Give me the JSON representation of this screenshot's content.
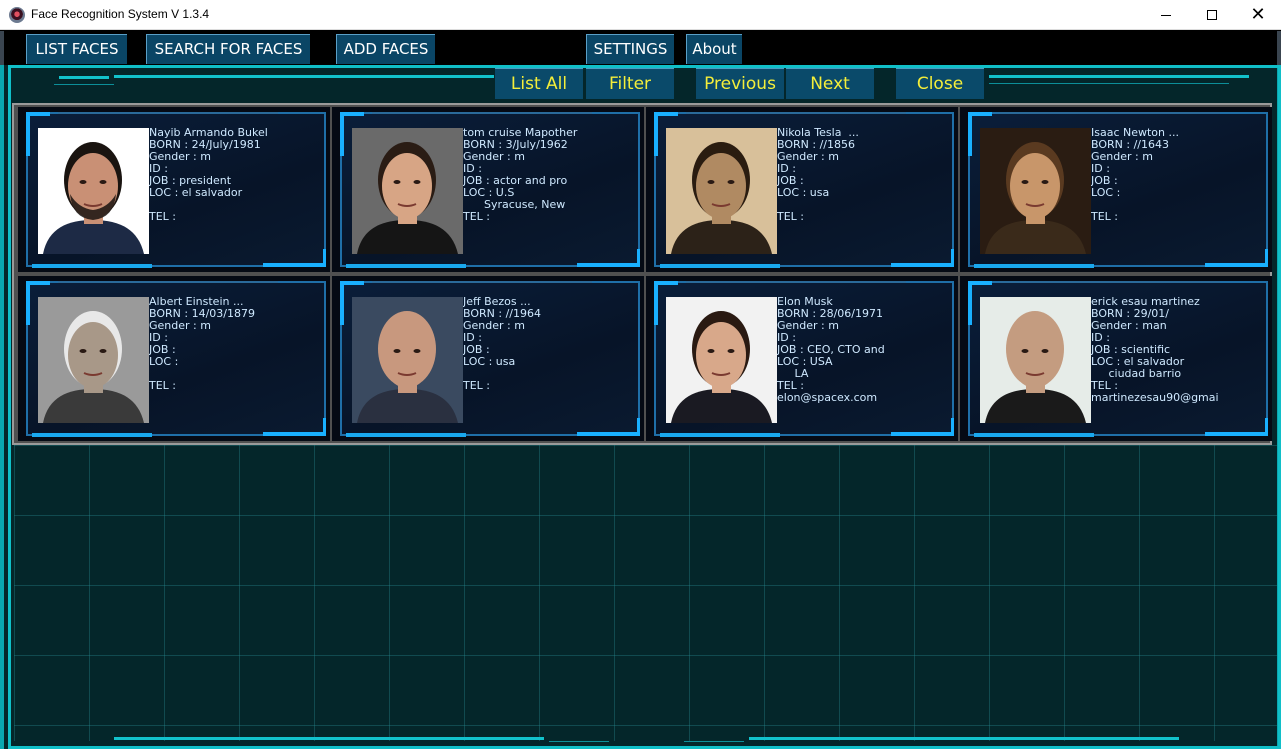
{
  "window": {
    "title": "Face Recognition System V 1.3.4",
    "minimize_glyph": "",
    "maximize_glyph": "",
    "close_glyph": "✕"
  },
  "menu": {
    "list_faces": "LIST FACES",
    "search_faces": "SEARCH FOR FACES",
    "add_faces": "ADD FACES",
    "settings": "SETTINGS",
    "about": "About"
  },
  "actions": {
    "list_all": "List All",
    "filter": "Filter",
    "previous": "Previous",
    "next": "Next",
    "close": "Close"
  },
  "cards": [
    {
      "lines": [
        "Nayib Armando Bukel",
        "BORN : 24/July/1981",
        "Gender : m",
        "ID :",
        "JOB : president",
        "LOC : el salvador",
        "",
        "TEL :"
      ],
      "photo": {
        "skin": "#c99075",
        "hair": "#1a1410",
        "bg": "#ffffff",
        "shirt": "#1d2a45",
        "beard": true
      }
    },
    {
      "lines": [
        "tom cruise Mapother",
        "BORN : 3/July/1962",
        "Gender : m",
        "ID :",
        "JOB : actor and pro",
        "LOC : U.S",
        "      Syracuse, New",
        "TEL :"
      ],
      "photo": {
        "skin": "#d7a585",
        "hair": "#2a1c14",
        "bg": "#6a6a6a",
        "shirt": "#151515",
        "beard": false
      }
    },
    {
      "lines": [
        "Nikola Tesla  ...",
        "BORN : //1856",
        "Gender : m",
        "ID :",
        "JOB :",
        "LOC : usa",
        "",
        "TEL :"
      ],
      "photo": {
        "skin": "#b08a62",
        "hair": "#2a1c10",
        "bg": "#d8c09a",
        "shirt": "#2c2218",
        "beard": false
      }
    },
    {
      "lines": [
        "Isaac Newton ...",
        "BORN : //1643",
        "Gender : m",
        "ID :",
        "JOB :",
        "LOC :",
        "",
        "TEL :"
      ],
      "photo": {
        "skin": "#c8966a",
        "hair": "#5a3a20",
        "bg": "#2a1c12",
        "shirt": "#3a2a1a",
        "beard": false
      }
    },
    {
      "lines": [
        "Albert Einstein ...",
        "BORN : 14/03/1879",
        "Gender : m",
        "ID :",
        "JOB :",
        "LOC :",
        "",
        "TEL :"
      ],
      "photo": {
        "skin": "#a89888",
        "hair": "#e8e8e8",
        "bg": "#9a9a9a",
        "shirt": "#3a3a3a",
        "beard": false
      }
    },
    {
      "lines": [
        "Jeff Bezos ...",
        "BORN : //1964",
        "Gender : m",
        "ID :",
        "JOB :",
        "LOC : usa",
        "",
        "TEL :"
      ],
      "photo": {
        "skin": "#c8987e",
        "hair": "#c8987e",
        "bg": "#3a4a60",
        "shirt": "#2a3040",
        "beard": false
      }
    },
    {
      "lines": [
        "Elon Musk",
        "BORN : 28/06/1971",
        "Gender : m",
        "ID :",
        "JOB : CEO, CTO and",
        "LOC : USA",
        "     LA",
        "TEL :",
        "elon@spacex.com"
      ],
      "photo": {
        "skin": "#d8a88a",
        "hair": "#2a1a12",
        "bg": "#f2f2f2",
        "shirt": "#1a1a22",
        "beard": false
      }
    },
    {
      "lines": [
        "erick esau martinez",
        "BORN : 29/01/",
        "Gender : man",
        "ID :",
        "JOB : scientific",
        "LOC : el salvador",
        "     ciudad barrio",
        "TEL :",
        "martinezesau90@gmai"
      ],
      "photo": {
        "skin": "#c49c80",
        "hair": "#c49c80",
        "bg": "#e6ece8",
        "shirt": "#1a1a1a",
        "beard": false
      }
    }
  ]
}
